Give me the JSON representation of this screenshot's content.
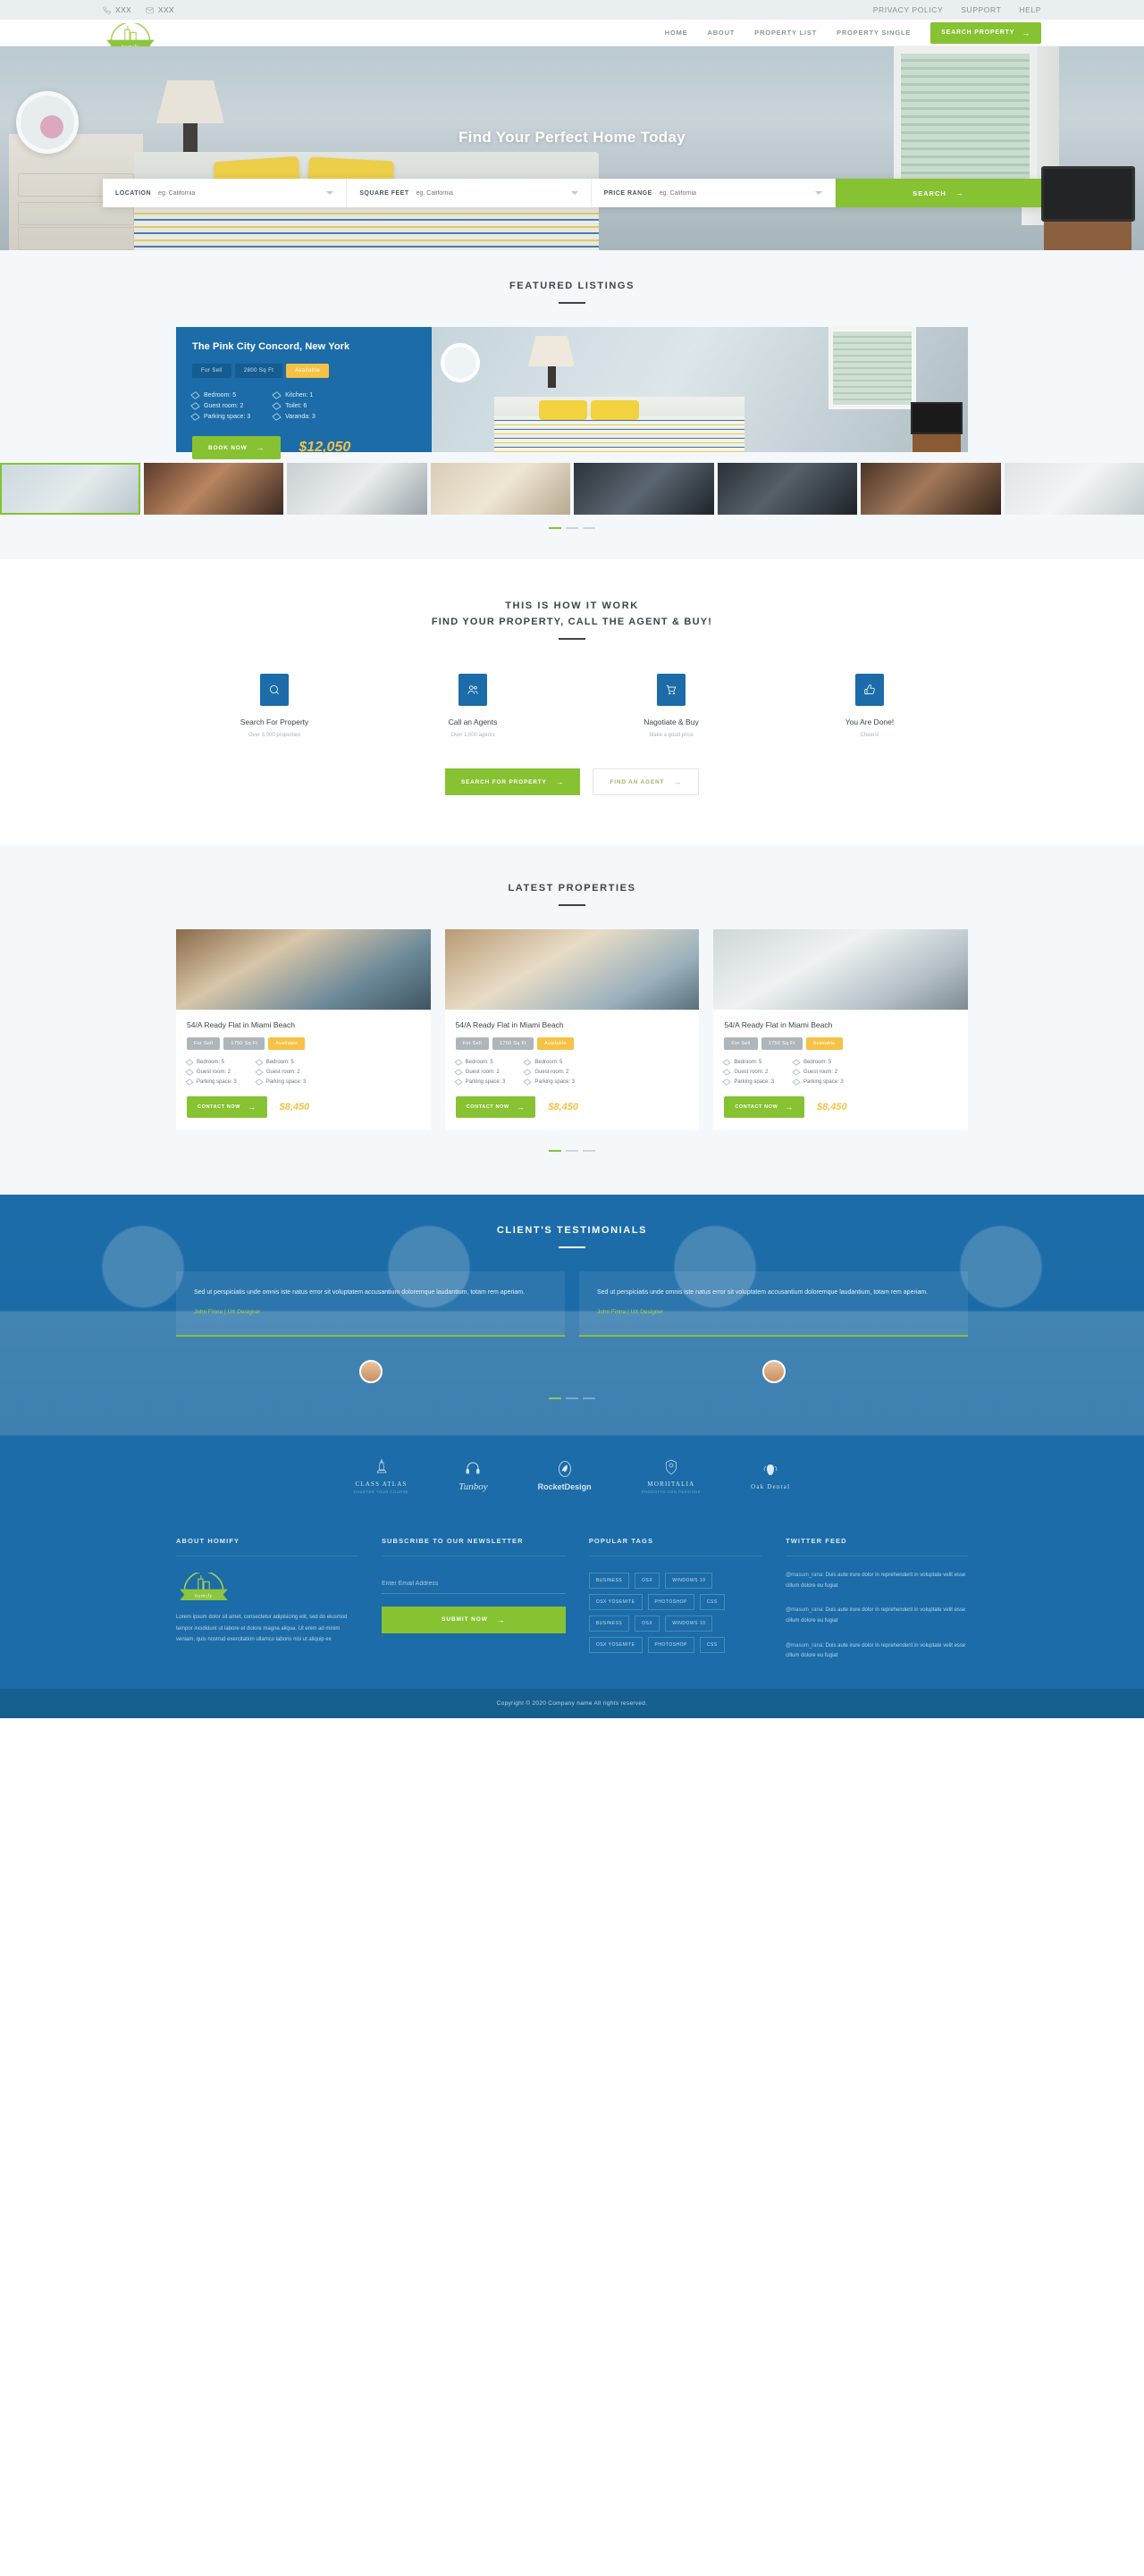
{
  "topbar": {
    "phone": "XXX",
    "email": "XXX",
    "links": [
      "PRIVACY POLICY",
      "SUPPORT",
      "HELP"
    ]
  },
  "header": {
    "logo_text": "homify",
    "nav": [
      "HOME",
      "ABOUT",
      "PROPERTY LIST",
      "PROPERTY SINGLE"
    ],
    "cta": "SEARCH PROPERTY"
  },
  "hero": {
    "title": "Find Your Perfect Home Today",
    "search": {
      "fields": [
        {
          "label": "LOCATION",
          "placeholder": "eg. California",
          "value": ""
        },
        {
          "label": "SQUARE FEET",
          "placeholder": "eg. California",
          "value": ""
        },
        {
          "label": "PRICE RANGE",
          "placeholder": "eg. California",
          "value": ""
        }
      ],
      "button": "SEARCH"
    }
  },
  "featured": {
    "title": "FEATURED LISTINGS",
    "card": {
      "title": "The Pink City Concord, New York",
      "tags": [
        "For Sell",
        "2800 Sq Ft",
        "Available"
      ],
      "specs_left": [
        "Bedroom: 5",
        "Guest room: 2",
        "Parking space: 3"
      ],
      "specs_right": [
        "Kitchen: 1",
        "Toilet: 6",
        "Varanda: 3"
      ],
      "button": "BOOK NOW",
      "price": "$12,050"
    }
  },
  "how": {
    "title": "THIS IS HOW IT WORK",
    "subtitle": "FIND YOUR PROPERTY, CALL THE AGENT & BUY!",
    "steps": [
      {
        "icon": "search-icon",
        "title": "Search For Property",
        "desc": "Over 3,000 properties"
      },
      {
        "icon": "agents-icon",
        "title": "Call an Agents",
        "desc": "Over 1,000 agents"
      },
      {
        "icon": "cart-icon",
        "title": "Nagotiate & Buy",
        "desc": "Make a good price"
      },
      {
        "icon": "thumbs-up-icon",
        "title": "You Are Done!",
        "desc": "Cheers!"
      }
    ],
    "cta_primary": "SEARCH FOR PROPERTY",
    "cta_secondary": "FIND AN AGENT"
  },
  "latest": {
    "title": "LATEST PROPERTIES",
    "items": [
      {
        "title": "54/A Ready Flat in Miami Beach",
        "tags": [
          "For Sell",
          "1750 Sq Ft",
          "Available"
        ],
        "specs_left": [
          "Bedroom: 5",
          "Guest room: 2",
          "Parking space: 3"
        ],
        "specs_right": [
          "Bedroom: 5",
          "Guest room: 2",
          "Parking space: 3"
        ],
        "button": "CONTACT NOW",
        "price": "$8,450"
      },
      {
        "title": "54/A Ready Flat in Miami Beach",
        "tags": [
          "For Sell",
          "1750 Sq Ft",
          "Available"
        ],
        "specs_left": [
          "Bedroom: 5",
          "Guest room: 2",
          "Parking space: 3"
        ],
        "specs_right": [
          "Bedroom: 5",
          "Guest room: 2",
          "Parking space: 3"
        ],
        "button": "CONTACT NOW",
        "price": "$8,450"
      },
      {
        "title": "54/A Ready Flat in Miami Beach",
        "tags": [
          "For Sell",
          "1750 Sq Ft",
          "Available"
        ],
        "specs_left": [
          "Bedroom: 5",
          "Guest room: 2",
          "Parking space: 3"
        ],
        "specs_right": [
          "Bedroom: 5",
          "Guest room: 2",
          "Parking space: 3"
        ],
        "button": "CONTACT NOW",
        "price": "$8,450"
      }
    ]
  },
  "testimonials": {
    "title": "CLIENT'S TESTIMONIALS",
    "items": [
      {
        "quote": "Sed ut perspiciatis unde omnis iste natus error sit voluptatem accusantium doloremque laudantium, totam rem aperiam.",
        "author": "John Finna | UX Designer"
      },
      {
        "quote": "Sed ut perspiciatis unde omnis iste natus error sit voluptatem accusantium doloremque laudantium, totam rem aperiam.",
        "author": "John Finna | UX Designer"
      }
    ]
  },
  "brands": [
    {
      "name": "CLASS ATLAS",
      "sub": "CHARTER YOUR COURSE",
      "style": "serif"
    },
    {
      "name": "Tunboy",
      "sub": "",
      "style": "script"
    },
    {
      "name": "RocketDesign",
      "sub": "",
      "style": "bold"
    },
    {
      "name": "MORIITALIA",
      "sub": "PRODOTTO CON PASSIONE",
      "style": "serif"
    },
    {
      "name": "Oak Dental",
      "sub": "",
      "style": "serif"
    }
  ],
  "footer": {
    "about": {
      "heading": "ABOUT HOMIFY",
      "logo_text": "homify",
      "text": "Lorem ipsum dolor sit amet, consectetur adipisicing elit, sed do eiusmod tempor incididunt ut labore et dolore magna aliqua. Ut enim ad minim veniam, quis nostrud exercitation ullamco laboris nisi ut aliquip ex"
    },
    "newsletter": {
      "heading": "SUBSCRIBE TO OUR NEWSLETTER",
      "placeholder": "Enter Email Address",
      "value": "",
      "button": "SUBMIT NOW"
    },
    "tags": {
      "heading": "POPULAR TAGS",
      "items": [
        "BUSINESS",
        "OSX",
        "WINDOWS 10",
        "OSX YOSEMITE",
        "PHOTOSHOP",
        "CSS",
        "BUSINESS",
        "OSX",
        "WINDOWS 10",
        "OSX YOSEMITE",
        "PHOTOSHOP",
        "CSS"
      ]
    },
    "twitter": {
      "heading": "TWITTER FEED",
      "items": [
        {
          "handle": "@masum_rana:",
          "text": "Duis aute irure dolor in reprehenderit in voluptate velit esse cillum dolore eu fugiat"
        },
        {
          "handle": "@masum_rana:",
          "text": "Duis aute irure dolor in reprehenderit in voluptate velit esse cillum dolore eu fugiat"
        },
        {
          "handle": "@masum_rana:",
          "text": "Duis aute irure dolor in reprehenderit in voluptate velit esse cillum dolore eu fugiat"
        }
      ]
    },
    "copyright": "Copyright © 2020 Company name All rights reserved."
  },
  "colors": {
    "green": "#86c232",
    "blue": "#1b6ca8",
    "yellow": "#f5c244",
    "light": "#f4f8fa"
  }
}
